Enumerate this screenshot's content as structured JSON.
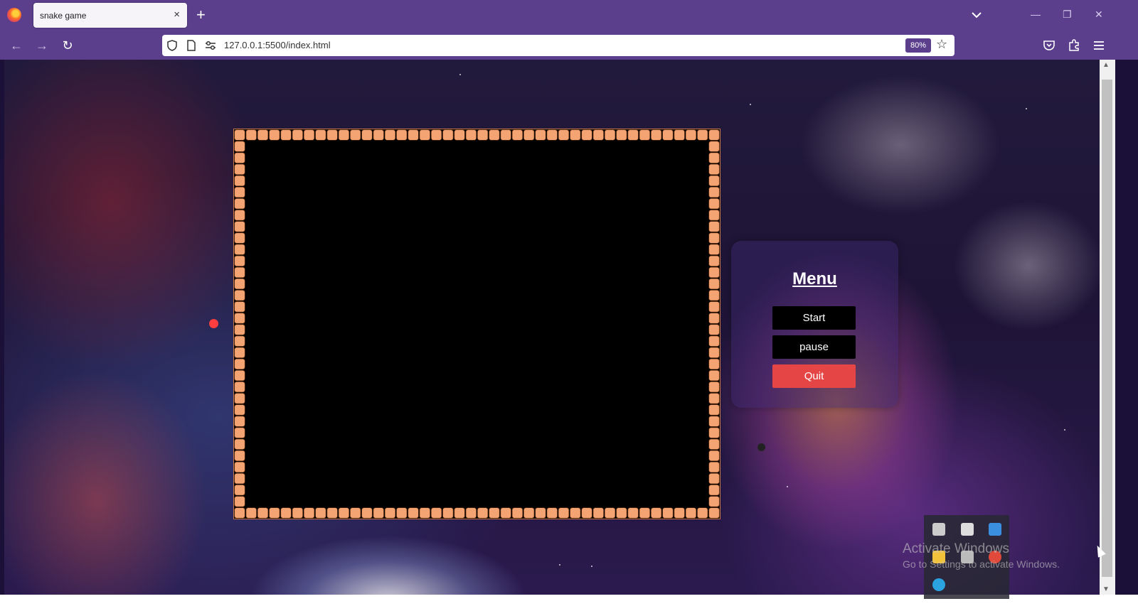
{
  "browser": {
    "tab_title": "snake game",
    "tab_close": "×",
    "new_tab": "+",
    "url": "127.0.0.1:5500/index.html",
    "zoom": "80%",
    "accent": "#5b3f8c"
  },
  "icons": [
    "firefox-logo-icon",
    "back-icon",
    "forward-icon",
    "reload-icon",
    "shield-icon",
    "page-icon",
    "site-settings-icon",
    "bookmark-star-icon",
    "pocket-icon",
    "extensions-icon",
    "hamburger-menu-icon"
  ],
  "menu": {
    "title": "Menu",
    "start": "Start",
    "pause": "pause",
    "quit": "Quit",
    "quit_color": "#e64545"
  },
  "game": {
    "board_color": "#000000",
    "border_tile_color": "#f4a473"
  },
  "watermark": {
    "line1": "Activate Windows",
    "line2": "Go to Settings to activate Windows."
  }
}
